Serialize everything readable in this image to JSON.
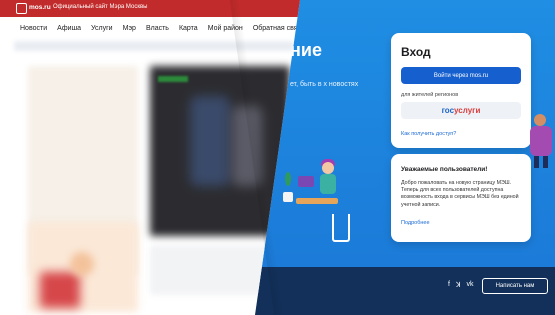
{
  "left_page": {
    "topbar": {
      "brand": "mos.ru",
      "slogan": "Официальный сайт Мэра Москвы",
      "bar_color": "#c22b2b"
    },
    "nav_items": [
      "Новости",
      "Афиша",
      "Услуги",
      "Мэр",
      "Власть",
      "Карта",
      "Мой район",
      "Обратная связь"
    ]
  },
  "right_page": {
    "hero": {
      "title": "ние",
      "text": "ет, быть в\nх новостях"
    },
    "login_card": {
      "title": "Вход",
      "mos_button": "Войти через mos.ru",
      "regions_label": "для жителей регионов",
      "gosuslugi_part1": "гос",
      "gosuslugi_part2": "услуги",
      "how_link": "Как получить доступ?"
    },
    "notice_card": {
      "title": "Уважаемые пользователи!",
      "body": "Добро пожаловать на новую страницу МЭШ. Теперь для всех пользователей доступна возможность входа в сервисы МЭШ без единой учетной записи.",
      "more": "Подробнее"
    },
    "footer": {
      "social": [
        "f",
        "ꓘ",
        "vk"
      ],
      "write_button": "Написать нам",
      "bg": "#12305a"
    },
    "colors": {
      "background": "#1e8ce0",
      "primary_button": "#155fcf",
      "link": "#1a6ad4"
    }
  }
}
